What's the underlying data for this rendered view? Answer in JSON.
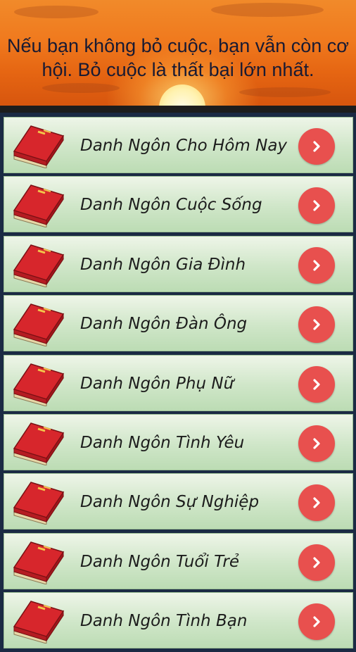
{
  "banner": {
    "quote": "Nếu bạn không bỏ cuộc, bạn vẫn còn cơ hội. Bỏ cuộc là thất bại lớn nhất."
  },
  "menu": {
    "items": [
      {
        "label": "Danh Ngôn Cho Hôm Nay",
        "icon": "book-icon",
        "action_icon": "chevron-right-icon"
      },
      {
        "label": "Danh Ngôn Cuộc Sống",
        "icon": "book-icon",
        "action_icon": "chevron-right-icon"
      },
      {
        "label": "Danh Ngôn Gia Đình",
        "icon": "book-icon",
        "action_icon": "chevron-right-icon"
      },
      {
        "label": "Danh Ngôn Đàn Ông",
        "icon": "book-icon",
        "action_icon": "chevron-right-icon"
      },
      {
        "label": "Danh Ngôn Phụ Nữ",
        "icon": "book-icon",
        "action_icon": "chevron-right-icon"
      },
      {
        "label": "Danh Ngôn Tình Yêu",
        "icon": "book-icon",
        "action_icon": "chevron-right-icon"
      },
      {
        "label": "Danh Ngôn Sự Nghiệp",
        "icon": "book-icon",
        "action_icon": "chevron-right-icon"
      },
      {
        "label": "Danh Ngôn Tuổi Trẻ",
        "icon": "book-icon",
        "action_icon": "chevron-right-icon"
      },
      {
        "label": "Danh Ngôn Tình Bạn",
        "icon": "book-icon",
        "action_icon": "chevron-right-icon"
      }
    ]
  },
  "colors": {
    "row_background": "#cfe6c8",
    "arrow_button": "#e8504e",
    "book_cover": "#d7262c",
    "banner_top": "#f18a2a",
    "banner_bottom": "#d4520d"
  }
}
